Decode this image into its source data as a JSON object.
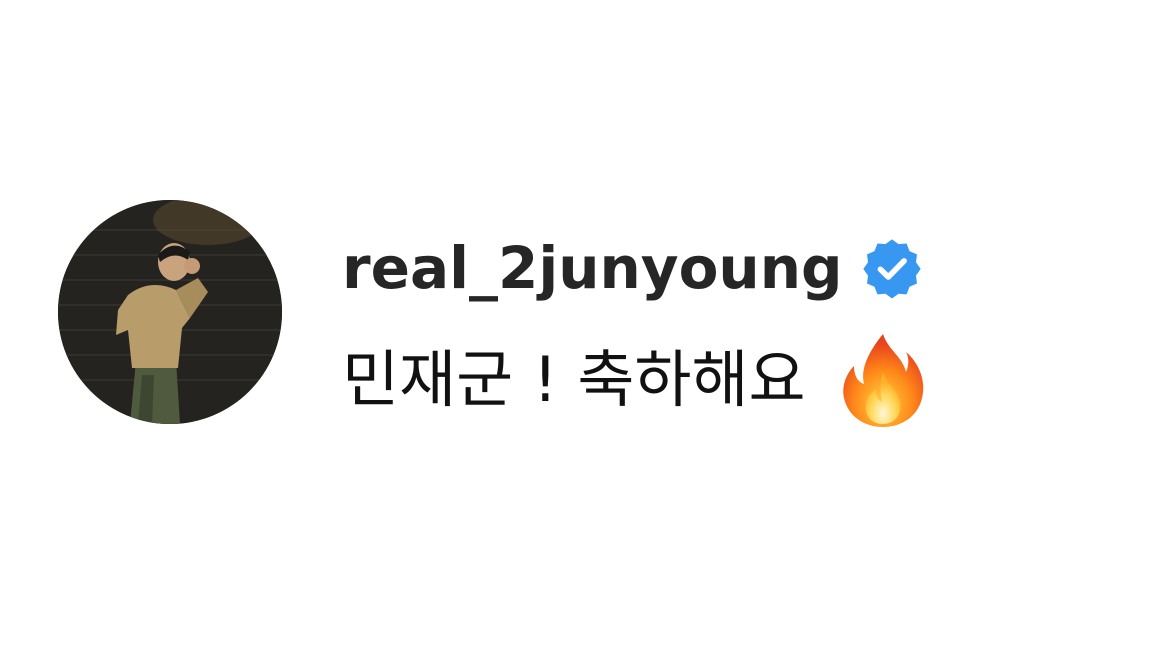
{
  "comment": {
    "username": "real_2junyoung",
    "verified": true,
    "verified_icon": "verified-badge-icon",
    "text": "민재군 ! 축하해요",
    "emoji_icon": "fire-emoji-icon"
  },
  "colors": {
    "username": "#262626",
    "text": "#111111",
    "verified_badge": "#3897f0",
    "background": "#ffffff"
  }
}
